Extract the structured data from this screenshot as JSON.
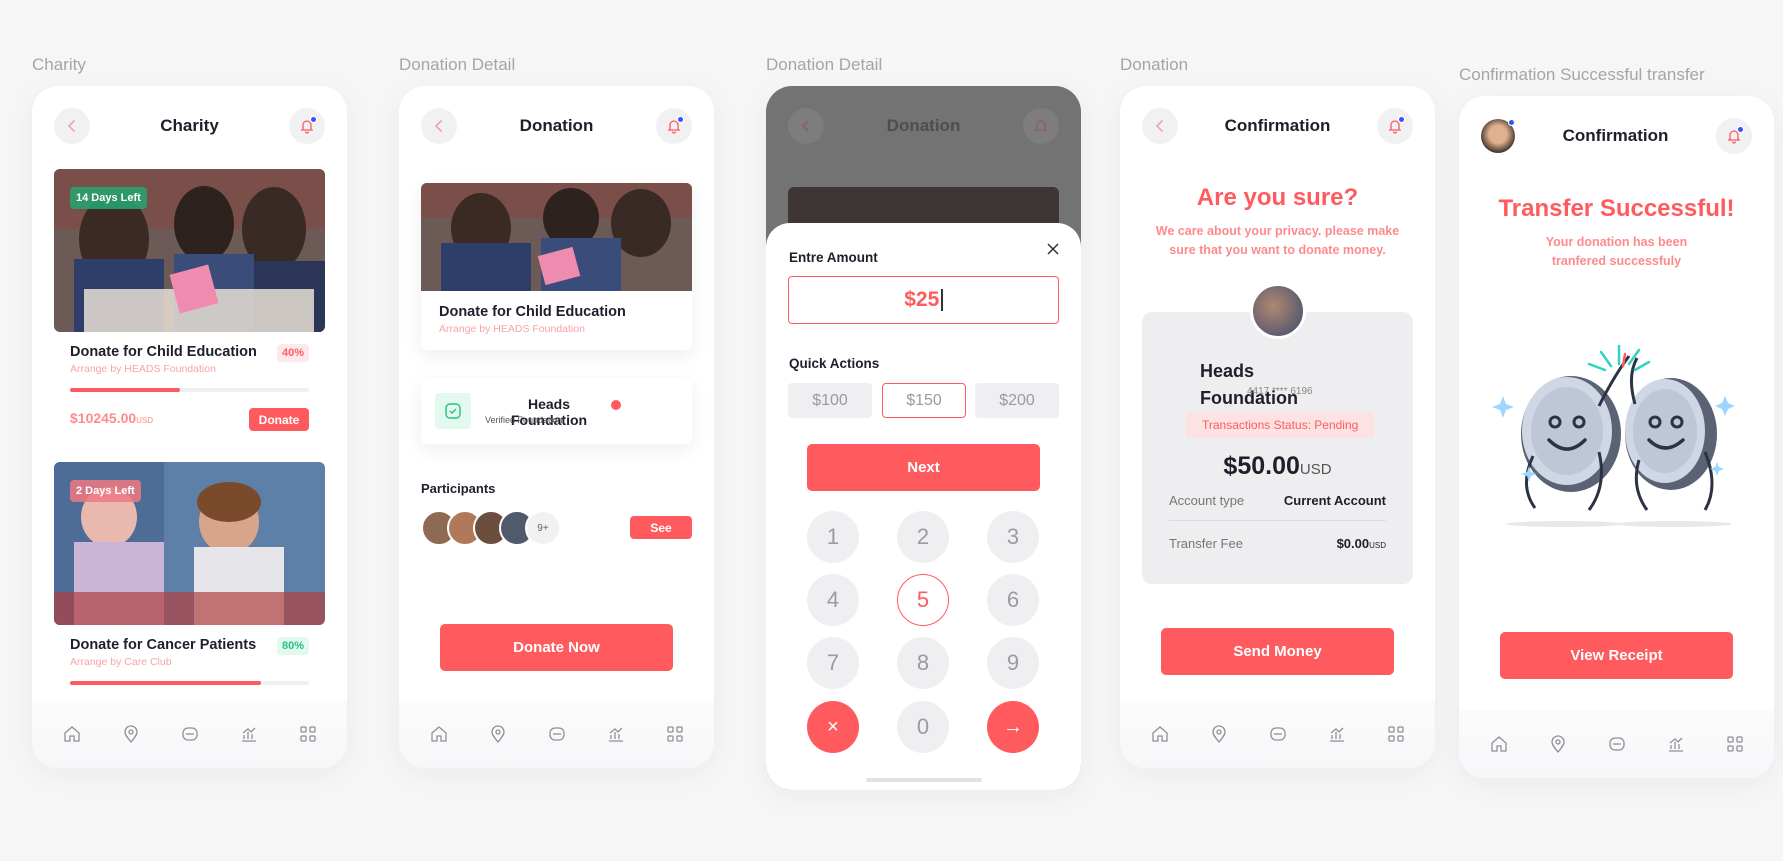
{
  "colors": {
    "accent": "#ff5b5f",
    "green": "#23c383",
    "muted": "#a4a4ab"
  },
  "labels": {
    "s1": "Charity",
    "s2": "Donation Detail",
    "s3": "Donation Detail",
    "s4": "Donation",
    "s5": "Confirmation Successful transfer"
  },
  "screen1": {
    "title": "Charity",
    "cards": [
      {
        "days_left": "14 Days Left",
        "title": "Donate for Child Education",
        "subtitle": "Arrange by HEADS Foundation",
        "percent_text": "40%",
        "progress": 0.43,
        "amount": "$10245.00",
        "currency": "USD",
        "button": "Donate"
      },
      {
        "days_left": "2 Days Left",
        "title": "Donate for Cancer Patients",
        "subtitle": "Arrange by Care Club",
        "percent_text": "80%",
        "progress": 0.8
      }
    ]
  },
  "screen2": {
    "title": "Donation",
    "card_title": "Donate for Child Education",
    "card_subtitle": "Arrange by HEADS Foundation",
    "org_name": "Heads Foundation",
    "org_verified": "Verified Foundation",
    "participants_label": "Participants",
    "participants_more": "9+",
    "see_button": "See",
    "donate_button": "Donate Now"
  },
  "screen3": {
    "title": "Donation",
    "amount_label": "Entre Amount",
    "amount_value": "$25",
    "quick_actions_label": "Quick Actions",
    "quick_actions": [
      "$100",
      "$150",
      "$200"
    ],
    "next_button": "Next",
    "keys": [
      "1",
      "2",
      "3",
      "4",
      "5",
      "6",
      "7",
      "8",
      "9",
      "0"
    ],
    "clear_key": "×",
    "go_key": "→"
  },
  "screen4": {
    "title": "Confirmation",
    "heading": "Are you sure?",
    "sub": "We care about your privacy. please make sure that you want to donate money.",
    "org_name": "Heads Foundation",
    "org_account": "4417 **** 6196",
    "status": "Transactions Status: Pending",
    "amount": "$50.00",
    "currency": "USD",
    "account_type_label": "Account type",
    "account_type_value": "Current Account",
    "fee_label": "Transfer Fee",
    "fee_value": "$0.00",
    "fee_currency": "USD",
    "send_button": "Send Money"
  },
  "screen5": {
    "title": "Confirmation",
    "heading": "Transfer Successful!",
    "sub": "Your donation has been tranfered successfuly",
    "receipt_button": "View Receipt"
  }
}
